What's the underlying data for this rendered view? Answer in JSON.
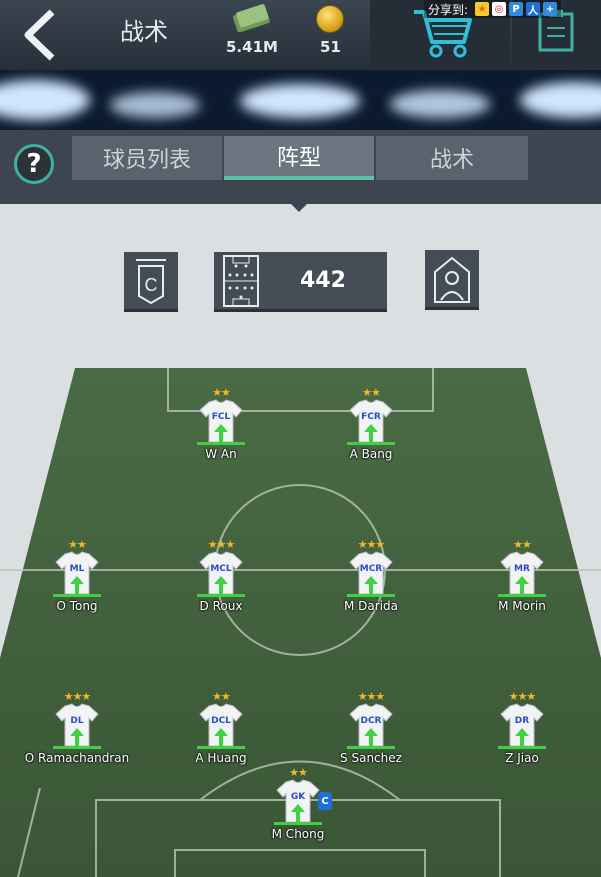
{
  "header": {
    "title": "战术",
    "money": "5.41M",
    "coins": "51",
    "share_label": "分享到:",
    "share_icons": [
      "qzone",
      "weibo",
      "pengyou",
      "renren",
      "more"
    ]
  },
  "tabs": [
    {
      "label": "球员列表",
      "active": false
    },
    {
      "label": "阵型",
      "active": true
    },
    {
      "label": "战术",
      "active": false
    }
  ],
  "help": "?",
  "formation": {
    "value": "442",
    "captain_icon_letter": "C"
  },
  "players": [
    {
      "pos": "FCL",
      "name": "W An",
      "stars": "★★",
      "captain": false
    },
    {
      "pos": "FCR",
      "name": "A Bang",
      "stars": "★★",
      "captain": false
    },
    {
      "pos": "ML",
      "name": "O Tong",
      "stars": "★★",
      "captain": false
    },
    {
      "pos": "MCL",
      "name": "D Roux",
      "stars": "★★★",
      "captain": false
    },
    {
      "pos": "MCR",
      "name": "M Darida",
      "stars": "★★★",
      "captain": false
    },
    {
      "pos": "MR",
      "name": "M Morin",
      "stars": "★★",
      "captain": false
    },
    {
      "pos": "DL",
      "name": "O Ramachandran",
      "stars": "★★★",
      "captain": false
    },
    {
      "pos": "DCL",
      "name": "A Huang",
      "stars": "★★",
      "captain": false
    },
    {
      "pos": "DCR",
      "name": "S Sanchez",
      "stars": "★★★",
      "captain": false
    },
    {
      "pos": "DR",
      "name": "Z Jiao",
      "stars": "★★★",
      "captain": false
    },
    {
      "pos": "GK",
      "name": "M Chong",
      "stars": "★★",
      "captain": true,
      "captain_letter": "C"
    }
  ],
  "colors": {
    "pitch_dark": "#3c5a38",
    "pitch_light": "#4d6e47",
    "accent": "#5fc0a8",
    "ready_bar": "#3fd043"
  }
}
